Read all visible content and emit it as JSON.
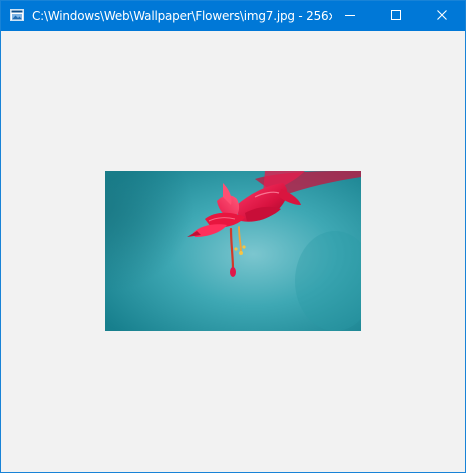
{
  "window": {
    "title": "C:\\Windows\\Web\\Wallpaper\\Flowers\\img7.jpg - 256x...",
    "accent_color": "#0078d7",
    "background_color": "#f2f2f2"
  },
  "icons": {
    "app": "image-window-icon",
    "minimize": "minimize-icon",
    "maximize": "maximize-icon",
    "close": "close-icon"
  },
  "image": {
    "subject": "pink flower on teal background"
  }
}
